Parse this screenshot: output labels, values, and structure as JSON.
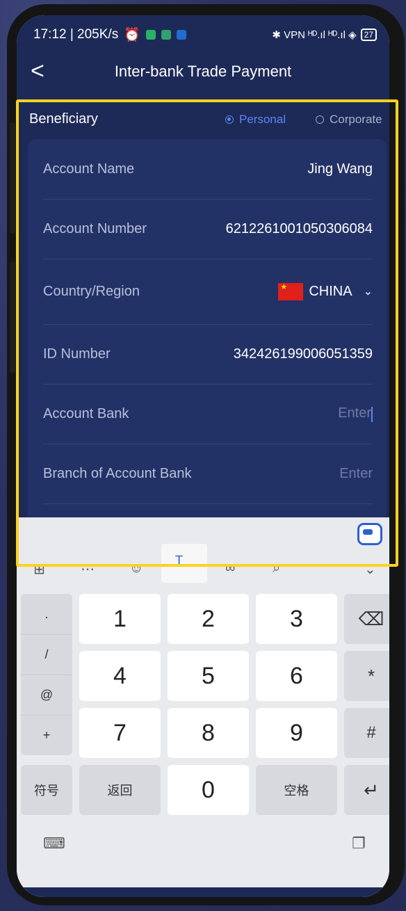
{
  "status_bar": {
    "time_speed": "17:12 | 205K/s",
    "right_icons": "✱ VPN ᴴᴰ.ıl ᴴᴰ.ıl ◈",
    "battery": "27"
  },
  "nav": {
    "back": "<",
    "title": "Inter-bank Trade Payment"
  },
  "beneficiary": {
    "label": "Beneficiary",
    "options": [
      {
        "label": "Personal",
        "selected": true
      },
      {
        "label": "Corporate",
        "selected": false
      }
    ]
  },
  "form": {
    "account_name": {
      "label": "Account Name",
      "value": "Jing Wang"
    },
    "account_number": {
      "label": "Account Number",
      "value": "6212261001050306084"
    },
    "country": {
      "label": "Country/Region",
      "value": "CHINA"
    },
    "id_number": {
      "label": "ID Number",
      "value": "342426199006051359"
    },
    "account_bank": {
      "label": "Account Bank",
      "placeholder": "Enter"
    },
    "branch": {
      "label": "Branch of Account Bank",
      "placeholder": "Enter"
    }
  },
  "keyboard": {
    "toolbar_icons": [
      "grid-icon",
      "keyboard-dots-icon",
      "emoji-icon",
      "text-cursor-icon",
      "link-icon",
      "search-icon",
      "collapse-icon"
    ],
    "digits": [
      "1",
      "2",
      "3",
      "4",
      "5",
      "6",
      "7",
      "8",
      "9",
      "0"
    ],
    "symbols": [
      ".",
      "/",
      "@",
      "+"
    ],
    "symbol_key": "符号",
    "back_key": "返回",
    "space_key": "空格",
    "star": "*",
    "hash": "#",
    "enter": "↵",
    "delete": "⌫"
  },
  "colors": {
    "header_bg": "#1d2a57",
    "card_bg": "#233266",
    "accent": "#5b86f0",
    "highlight": "#ffd21f"
  }
}
